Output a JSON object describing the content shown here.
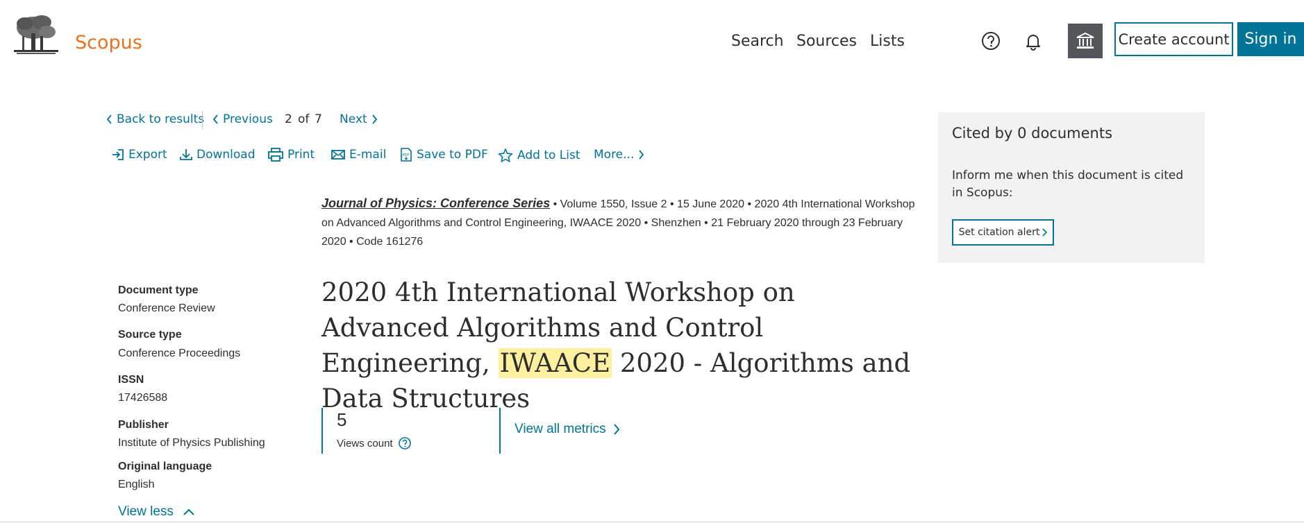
{
  "header": {
    "brand": "Scopus",
    "nav": [
      "Search",
      "Sources",
      "Lists"
    ],
    "create_account": "Create account",
    "sign_in": "Sign in"
  },
  "result_nav": {
    "back": "Back to results",
    "previous": "Previous",
    "current": "2",
    "of": "of",
    "total": "7",
    "next": "Next"
  },
  "toolbar": [
    "Export",
    "Download",
    "Print",
    "E-mail",
    "Save to PDF",
    "Add to List",
    "More..."
  ],
  "source": {
    "journal": "Journal of Physics: Conference Series",
    "volume": "Volume 1550, Issue 2",
    "date": "15 June 2020",
    "conference": "2020 4th International Workshop on Advanced Algorithms and Control Engineering, IWAACE 2020",
    "location": "Shenzhen",
    "conf_dates": "21 February 2020 through 23 February 2020",
    "code": "Code 161276",
    "bullet": "•"
  },
  "meta": {
    "document_type_label": "Document type",
    "document_type": "Conference Review",
    "source_type_label": "Source type",
    "source_type": "Conference Proceedings",
    "issn_label": "ISSN",
    "issn": "17426588",
    "publisher_label": "Publisher",
    "publisher": "Institute of Physics Publishing",
    "language_label": "Original language",
    "language": "English",
    "view_less": "View less"
  },
  "title": {
    "before": "2020 4th International Workshop on Advanced Algorithms and Control Engineering,",
    "highlight": "IWAACE",
    "after": "2020 - Algorithms and Data Structures"
  },
  "metrics": {
    "views": "5",
    "views_label": "Views count",
    "view_all": "View all metrics"
  },
  "cited": {
    "title": "Cited by 0 documents",
    "text": "Inform me when this document is cited in Scopus:",
    "alert_button": "Set citation alert"
  },
  "colors": {
    "brand": "#e9711c",
    "link": "#007398",
    "highlight": "#fff0a0"
  }
}
